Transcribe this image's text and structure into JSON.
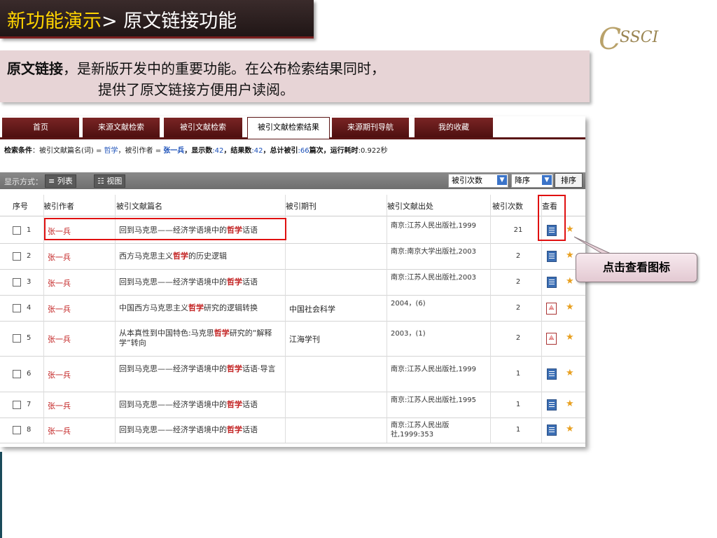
{
  "header": {
    "title_highlight": "新功能演示",
    "title_rest": "> 原文链接功能"
  },
  "logo": {
    "c": "C",
    "text": "SSCI"
  },
  "description": {
    "bold": "原文链接",
    "line1_rest": "，是新版开发中的重要功能。在公布检索结果同时，",
    "line2": "提供了原文链接方便用户读阅。"
  },
  "nav": {
    "tabs": [
      "首页",
      "来源文献检索",
      "被引文献检索",
      "被引文献检索结果",
      "来源期刊导航",
      "我的收藏"
    ],
    "active_index": 3
  },
  "search_condition": {
    "label": "检索条件",
    "p1": "：被引文献篇名(词) = ",
    "keyword": "哲学",
    "p2": "，被引作者 = ",
    "author": "张一兵",
    "p3": "，显示数",
    "display_count": ":42",
    "p4": "，结果数",
    "result_count": ":42",
    "p5": "，总计被引",
    "total_cited": ":66",
    "p6": "篇次，运行耗时",
    "time": ":0.922秒"
  },
  "toolbar": {
    "display_label": "显示方式：",
    "list_label": "≡ 列表",
    "view_label": "☷ 视图",
    "sort_field": "被引次数",
    "sort_order": "降序",
    "sort_button": "排序"
  },
  "table": {
    "headers": [
      "序号",
      "被引作者",
      "被引文献篇名",
      "被引期刊",
      "被引文献出处",
      "被引次数",
      "查看"
    ],
    "rows": [
      {
        "seq": "1",
        "author": "张一兵",
        "t1": "回到马克思——经济学语境中的",
        "kw": "哲学",
        "t2": "话语",
        "journal": "",
        "source": "南京:江苏人民出版社,1999",
        "count": "21",
        "icon": "doc"
      },
      {
        "seq": "2",
        "author": "张一兵",
        "t1": "西方马克思主义",
        "kw": "哲学",
        "t2": "的历史逻辑",
        "journal": "",
        "source": "南京:南京大学出版社,2003",
        "count": "2",
        "icon": "doc"
      },
      {
        "seq": "3",
        "author": "张一兵",
        "t1": "回到马克思——经济学语境中的",
        "kw": "哲学",
        "t2": "话语",
        "journal": "",
        "source": "南京:江苏人民出版社,2003",
        "count": "2",
        "icon": "doc"
      },
      {
        "seq": "4",
        "author": "张一兵",
        "t1": "中国西方马克思主义",
        "kw": "哲学",
        "t2": "研究的逻辑转换",
        "journal": "中国社会科学",
        "source": "2004，(6)",
        "count": "2",
        "icon": "pdf"
      },
      {
        "seq": "5",
        "author": "张一兵",
        "t1": "从本真性到中国特色:马克思",
        "kw": "哲学",
        "t2": "研究的“解释学”转向",
        "journal": "江海学刊",
        "source": "2003，(1)",
        "count": "2",
        "icon": "pdf"
      },
      {
        "seq": "6",
        "author": "张一兵",
        "t1": "回到马克思——经济学语境中的",
        "kw": "哲学",
        "t2": "话语·导言",
        "journal": "",
        "source": "南京:江苏人民出版社,1999",
        "count": "1",
        "icon": "doc"
      },
      {
        "seq": "7",
        "author": "张一兵",
        "t1": "回到马克思——经济学语境中的",
        "kw": "哲学",
        "t2": "话语",
        "journal": "",
        "source": "南京:江苏人民出版社,1995",
        "count": "1",
        "icon": "doc"
      },
      {
        "seq": "8",
        "author": "张一兵",
        "t1": "回到马克思——经济学语境中的",
        "kw": "哲学",
        "t2": "话语",
        "journal": "",
        "source": "南京:江苏人民出版社,1999:353",
        "count": "1",
        "icon": "doc"
      }
    ]
  },
  "callout": {
    "text": "点击查看图标"
  },
  "colors": {
    "accent": "#ffd400",
    "keyword": "#c22020",
    "highlight_box": "#e01010"
  }
}
